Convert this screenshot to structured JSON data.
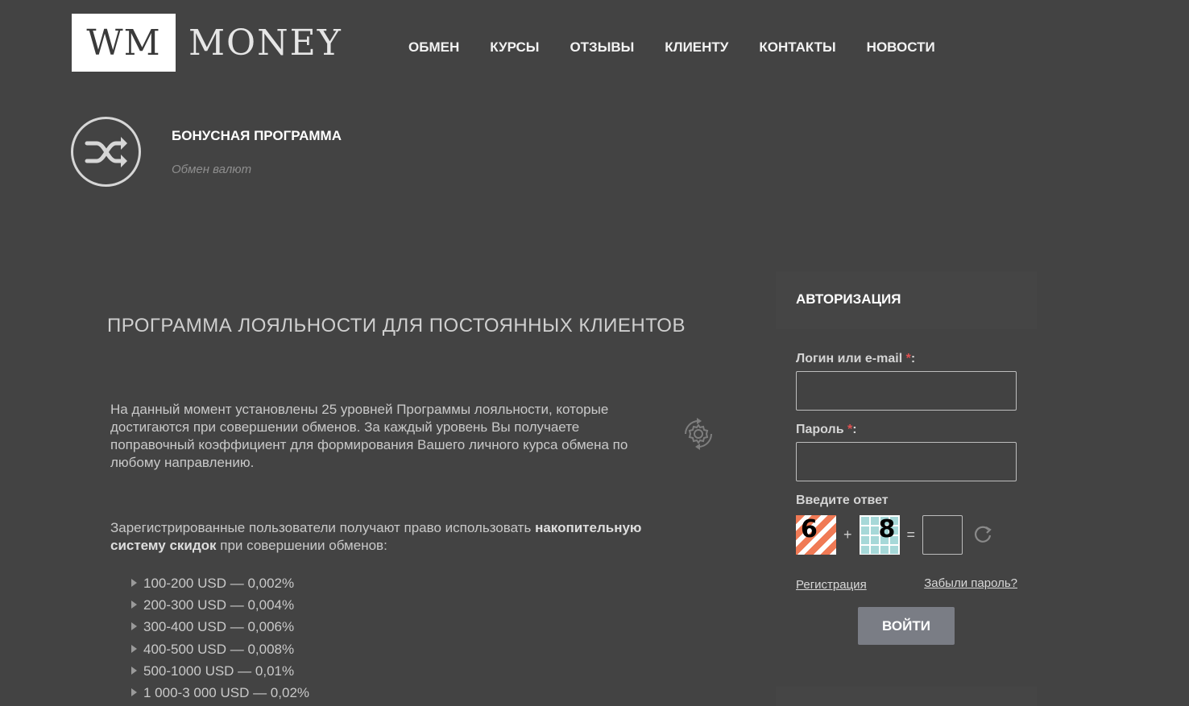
{
  "header": {
    "logo_box": "WM",
    "logo_text": "MONEY",
    "nav": [
      "ОБМЕН",
      "КУРСЫ",
      "ОТЗЫВЫ",
      "КЛИЕНТУ",
      "КОНТАКТЫ",
      "НОВОСТИ"
    ]
  },
  "page": {
    "icon": "shuffle-icon",
    "title": "БОНУСНАЯ ПРОГРАММА",
    "subtitle": "Обмен валют"
  },
  "main": {
    "heading": "ПРОГРАММА ЛОЯЛЬНОСТИ ДЛЯ ПОСТОЯННЫХ КЛИЕНТОВ",
    "paragraph1": "На данный момент установлены 25 уровней Программы лояльности, которые достигаются при совершении обменов. За каждый уровень Вы получаете поправочный коэффициент для формирования Вашего личного курса обмена по любому направлению.",
    "paragraph1_icon": "gear-refresh-icon",
    "paragraph2_pre": "Зарегистрированные пользователи получают право использовать ",
    "paragraph2_bold": "накопительную систему скидок",
    "paragraph2_post": " при совершении обменов:",
    "tiers": [
      "100-200 USD — 0,002%",
      "200-300 USD — 0,004%",
      "300-400  USD — 0,006%",
      "400-500 USD — 0,008%",
      "500-1000 USD — 0,01%",
      "1 000-3 000 USD — 0,02%"
    ]
  },
  "auth": {
    "title": "АВТОРИЗАЦИЯ",
    "login_label": "Логин или e-mail",
    "login_value": "",
    "password_label": "Пароль",
    "password_value": "",
    "required_mark": "*",
    "label_suffix": ":",
    "captcha_label": "Введите ответ",
    "captcha_a": "6",
    "captcha_b": "8",
    "captcha_plus": "+",
    "captcha_eq": "=",
    "captcha_value": "",
    "register_link": "Регистрация",
    "forgot_link": "Забыли пароль?",
    "submit_label": "ВОЙТИ"
  },
  "colors": {
    "background": "#434343",
    "button": "#7a7d85",
    "required": "#e05050"
  }
}
